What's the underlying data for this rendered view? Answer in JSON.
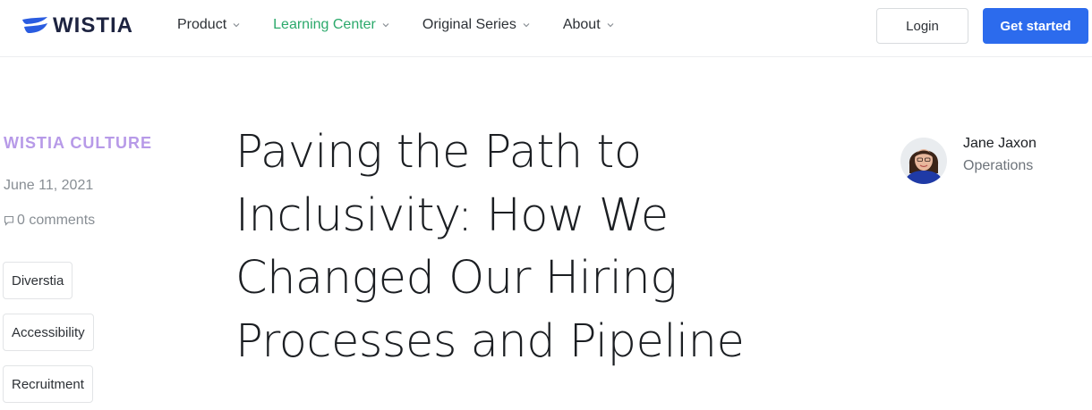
{
  "header": {
    "logo_text": "WISTIA",
    "nav": [
      {
        "label": "Product",
        "active": false
      },
      {
        "label": "Learning Center",
        "active": true
      },
      {
        "label": "Original Series",
        "active": false
      },
      {
        "label": "About",
        "active": false
      }
    ],
    "login_label": "Login",
    "get_started_label": "Get started",
    "colors": {
      "accent": "#2ba96b",
      "primary_button": "#2c6bed",
      "logo": "#1d2340"
    }
  },
  "article": {
    "category": "WISTIA CULTURE",
    "date": "June 11, 2021",
    "comments": "0 comments",
    "tags": [
      "Diverstia",
      "Accessibility",
      "Recruitment"
    ],
    "title_lines": [
      "Paving the Path to",
      "Inclusivity: How We",
      "Changed Our Hiring",
      "Processes and Pipeline"
    ],
    "author": {
      "name": "Jane Jaxon",
      "role": "Operations"
    },
    "colors": {
      "category": "#b79ae8"
    }
  }
}
